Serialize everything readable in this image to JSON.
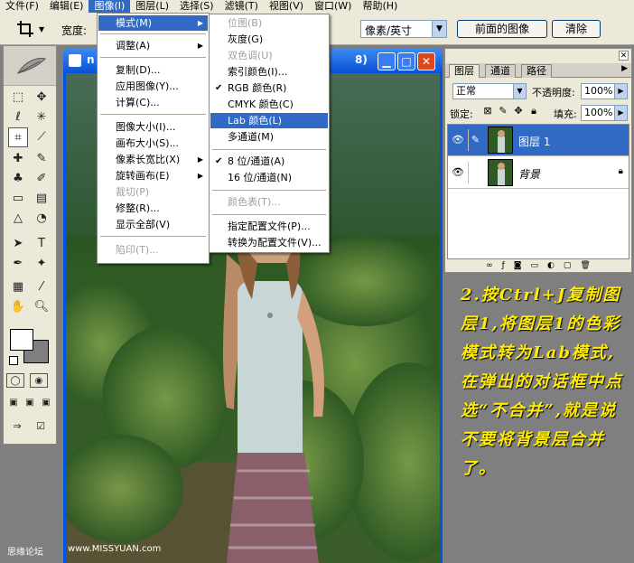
{
  "menubar": {
    "items": [
      "文件(F)",
      "编辑(E)",
      "图像(I)",
      "图层(L)",
      "选择(S)",
      "滤镜(T)",
      "视图(V)",
      "窗口(W)",
      "帮助(H)"
    ],
    "active_index": 2
  },
  "options_bar": {
    "width_label": "宽度:",
    "resolution_unit": "像素/英寸",
    "front_image_label": "前面的图像",
    "clear_label": "清除"
  },
  "image_menu": {
    "items": [
      "模式(M)",
      "调整(A)",
      "复制(D)...",
      "应用图像(Y)...",
      "计算(C)...",
      "图像大小(I)...",
      "画布大小(S)...",
      "像素长宽比(X)",
      "旋转画布(E)",
      "裁切(P)",
      "修整(R)...",
      "显示全部(V)",
      "陷印(T)..."
    ]
  },
  "mode_submenu": {
    "items": [
      "位图(B)",
      "灰度(G)",
      "双色调(U)",
      "索引颜色(I)...",
      "RGB 颜色(R)",
      "CMYK 颜色(C)",
      "Lab 颜色(L)",
      "多通道(M)",
      "8 位/通道(A)",
      "16 位/通道(N)",
      "颜色表(T)...",
      "指定配置文件(P)...",
      "转换为配置文件(V)..."
    ]
  },
  "document": {
    "title_prefix": "n",
    "title_suffix": "8)"
  },
  "layers_panel": {
    "tabs": [
      "图层",
      "通道",
      "路径"
    ],
    "blend_mode": "正常",
    "opacity_label": "不透明度:",
    "opacity_value": "100%",
    "lock_label": "锁定:",
    "fill_label": "填充:",
    "fill_value": "100%",
    "layers": [
      "图层 1",
      "背景"
    ]
  },
  "annotation": {
    "text": "2.按Ctrl+J复制图层1,将图层1的色彩模式转为Lab模式,在弹出的对话框中点选“不合并”,就是说不要将背景层合并了。"
  },
  "watermark": {
    "site": "思缘论坛",
    "url": "www.MISSYUAN.com"
  },
  "colors": {
    "menu_highlight": "#316ac5",
    "annotation_text": "#ffec00",
    "xp_title_blue": "#0054e3"
  }
}
